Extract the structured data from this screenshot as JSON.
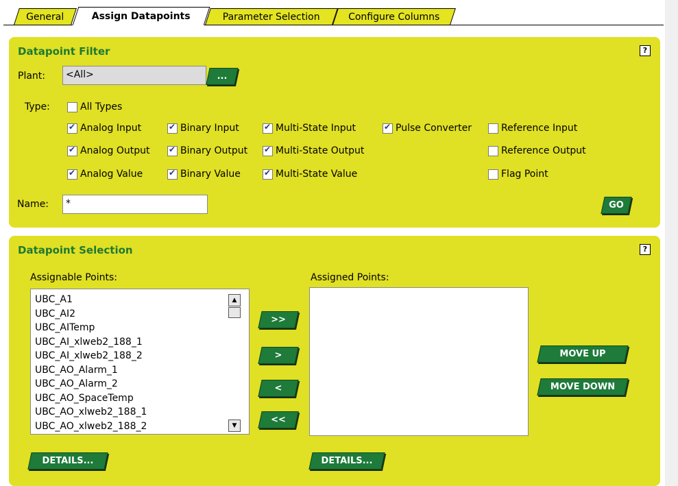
{
  "tabs": [
    {
      "label": "General",
      "active": false
    },
    {
      "label": "Assign Datapoints",
      "active": true
    },
    {
      "label": "Parameter Selection",
      "active": false
    },
    {
      "label": "Configure Columns",
      "active": false
    }
  ],
  "filter": {
    "title": "Datapoint Filter",
    "help": "?",
    "plant_label": "Plant:",
    "plant_value": "<All>",
    "browse_label": "...",
    "type_label": "Type:",
    "all_types": {
      "label": "All Types",
      "checked": false
    },
    "types": [
      {
        "label": "Analog Input",
        "checked": true
      },
      {
        "label": "Binary Input",
        "checked": true
      },
      {
        "label": "Multi-State Input",
        "checked": true
      },
      {
        "label": "Pulse Converter",
        "checked": true
      },
      {
        "label": "Reference Input",
        "checked": false
      },
      {
        "label": "Analog Output",
        "checked": true
      },
      {
        "label": "Binary Output",
        "checked": true
      },
      {
        "label": "Multi-State Output",
        "checked": true
      },
      {
        "label": "Reference Output",
        "checked": false
      },
      {
        "label": "Analog Value",
        "checked": true
      },
      {
        "label": "Binary Value",
        "checked": true
      },
      {
        "label": "Multi-State Value",
        "checked": true
      },
      {
        "label": "Flag Point",
        "checked": false
      }
    ],
    "name_label": "Name:",
    "name_value": "*",
    "go_label": "GO"
  },
  "selection": {
    "title": "Datapoint Selection",
    "help": "?",
    "assignable_label": "Assignable Points:",
    "assigned_label": "Assigned Points:",
    "assignable": [
      "UBC_A1",
      "UBC_AI2",
      "UBC_AITemp",
      "UBC_AI_xlweb2_188_1",
      "UBC_AI_xlweb2_188_2",
      "UBC_AO_Alarm_1",
      "UBC_AO_Alarm_2",
      "UBC_AO_SpaceTemp",
      "UBC_AO_xlweb2_188_1",
      "UBC_AO_xlweb2_188_2"
    ],
    "assigned": [],
    "add_all": ">>",
    "add": ">",
    "remove": "<",
    "remove_all": "<<",
    "move_up": "MOVE UP",
    "move_down": "MOVE DOWN",
    "details_left": "DETAILS...",
    "details_right": "DETAILS..."
  },
  "colors": {
    "panel": "#e0e024",
    "title": "#1f7a32",
    "button": "#1e7b3a"
  }
}
